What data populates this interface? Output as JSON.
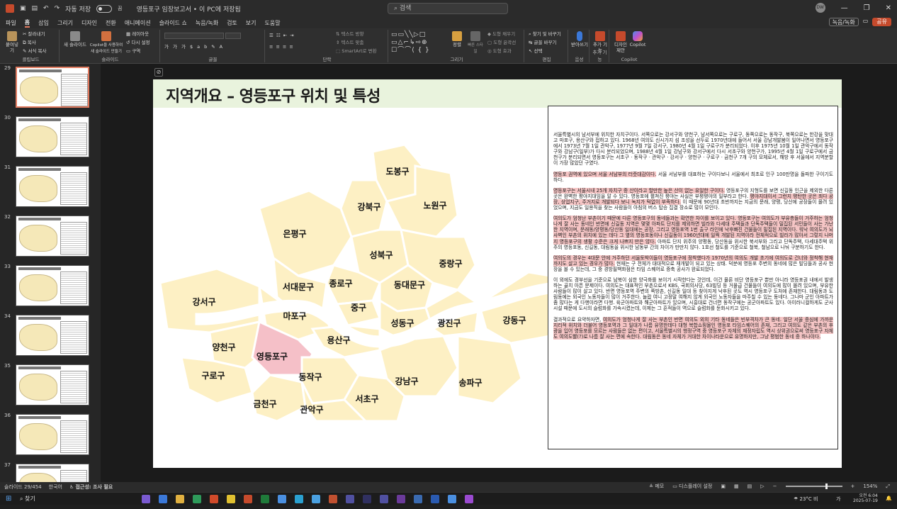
{
  "titlebar": {
    "autosave_label": "자동 저장",
    "autosave_state": "끔",
    "document_title": "영등포구 임장보고서 • 이 PC에 저장됨",
    "search_placeholder": "검색",
    "user_initials": "DW"
  },
  "tabs": [
    "파일",
    "홈",
    "삽입",
    "그리기",
    "디자인",
    "전환",
    "애니메이션",
    "슬라이드 쇼",
    "녹음/녹화",
    "검토",
    "보기",
    "도움말"
  ],
  "active_tab": "홈",
  "tabs_right": {
    "record": "녹음/녹화",
    "share": "공유"
  },
  "ribbon": {
    "clipboard": {
      "paste": "붙여넣기",
      "cut": "잘라내기",
      "copy": "복사",
      "format_painter": "서식 복사",
      "label": "클립보드"
    },
    "slides": {
      "new_slide": "새 슬라이드",
      "copilot": "Copilot을 사용하여 새 슬라이드 만들기",
      "layout": "레이아웃",
      "reset": "다시 설정",
      "section": "구역",
      "label": "슬라이드"
    },
    "font": {
      "label": "글꼴"
    },
    "paragraph": {
      "text_direction": "텍스트 방향",
      "align_text": "텍스트 맞춤",
      "smartart": "SmartArt로 변환",
      "label": "단락"
    },
    "drawing": {
      "arrange": "정렬",
      "quick_styles": "빠른 스타일",
      "shape_fill": "도형 채우기",
      "shape_outline": "도형 윤곽선",
      "shape_effects": "도형 효과",
      "label": "그리기"
    },
    "editing": {
      "find": "찾기 및 바꾸기",
      "replace": "글꼴 바꾸기",
      "select": "선택",
      "label": "편집"
    },
    "voice": {
      "dictate": "받아쓰기",
      "label": "음성"
    },
    "addins": {
      "addins": "추가 기능",
      "label": "추가 기능"
    },
    "designer": {
      "designer": "디자인 제안"
    },
    "copilot": {
      "copilot": "Copilot",
      "label": "Copilot"
    }
  },
  "thumbnails": [
    29,
    30,
    31,
    32,
    33,
    34,
    35,
    36,
    37
  ],
  "selected_thumbnail": 29,
  "slide": {
    "title": "지역개요 – 영등포구 위치 및 특성",
    "map_labels": [
      {
        "name": "도봉구",
        "highlight": false
      },
      {
        "name": "강북구",
        "highlight": false
      },
      {
        "name": "노원구",
        "highlight": false
      },
      {
        "name": "은평구",
        "highlight": false
      },
      {
        "name": "성북구",
        "highlight": false
      },
      {
        "name": "중랑구",
        "highlight": false
      },
      {
        "name": "종로구",
        "highlight": false
      },
      {
        "name": "서대문구",
        "highlight": false
      },
      {
        "name": "동대문구",
        "highlight": false
      },
      {
        "name": "강서구",
        "highlight": false
      },
      {
        "name": "마포구",
        "highlight": false
      },
      {
        "name": "중구",
        "highlight": false
      },
      {
        "name": "성동구",
        "highlight": false
      },
      {
        "name": "광진구",
        "highlight": false
      },
      {
        "name": "강동구",
        "highlight": false
      },
      {
        "name": "양천구",
        "highlight": false
      },
      {
        "name": "영등포구",
        "highlight": true
      },
      {
        "name": "용산구",
        "highlight": false
      },
      {
        "name": "구로구",
        "highlight": false
      },
      {
        "name": "동작구",
        "highlight": false
      },
      {
        "name": "강남구",
        "highlight": false
      },
      {
        "name": "송파구",
        "highlight": false
      },
      {
        "name": "서초구",
        "highlight": false
      },
      {
        "name": "금천구",
        "highlight": false
      },
      {
        "name": "관악구",
        "highlight": false
      }
    ],
    "paragraphs": [
      {
        "plain": "서울특별시의 남서부에 위치한 자치구이다. 서쪽으로는 강서구와 양천구, 남서쪽으로는 구로구, 동쪽으로는 동작구, 북쪽으로는 한강을 맞대고 마포구, 용산구와 접하고 있다. 1968년 여의도 신시가지 섬 조성을 선두로 1970년대에 들어서 서울 강남개발붐이 일어나면서 영등포구에서 1973년 7월 1일 관악구, 1977년 9월 7일 강서구, 1980년 4월 1일 구로구가 분리되었다. 이후 1975년 10월 1일 관악구에서 동작구와 강남구(일부)가 다시 분리되었으며, 1988년 4월 1일 강남구와 강서구에서 다시 서초구와 양천구가, 1995년 4월 1일 구로구에서 금천구가 분리되면서 영등포구는 서초구 · 동작구 · 관악구 · 강서구 · 양천구 · 구로구 · 금천구 7개 구의 모체로서, 해방 후 서울에서 지역분할이 가장 많았던 구였다."
      },
      {
        "hl": "영등포 권역에 있으며 서울 서남부의 터줏대감이다.",
        "plain": " 서울 서남부를 대표하는 구이다보니 서울에서 최초로 인구 100만명을 돌파한 구이기도 하다."
      },
      {
        "hl": "영등포구는 서울시내 25개 자치구 중 산이라고 할만한 높은 산이 없는 유일한 구이다.",
        "plain": " 영등포구의 지형도를 보면 신길동 인근을 제외한 다른 곳은 완벽한 평야지대임을 알 수 있다. 영등포에 펼쳐진 평야는 사실은 부평평야의 일부라고 한다. ",
        "hl2": "평야지대이서 그런지 평탄한 곳은 죄다 공장, 상업지구, 주거지로 개발되다 보니 녹지가 턱없이 부족하다.",
        "plain2": " 이 때문에 90년대 초반까지는 지금의 문래, 양평, 당산에 공장들이 몰려 있었으며, 지금도 일용직을 찾는 사람들이 아침의 버스 탑승 집결 장소로 많이 모인다."
      },
      {
        "hl": "여의도가 엄청난 부촌이기 때문에 다른 영등포구의 동네들과는 확연한 차이를 보이고 있다. 영등포구는 여의도가 부유층들이 거주하는 엄청나게 잘 사는 동네인 반면에 신길동 지역은 몇몇 아파트 단지를 제외하면 빌라와 다세대 주택들과 단독주택들이 밀집된 서민들이 사는 가난한 지역이며, 문래동/양평동/당산동 일대에는 공장, 그리고 영등포역 1번 출구 라인에 낙후빠진 건물들이 밀집된 지역이다. 워낙 여의도가 뇌사벽인 부촌의 위치에 있는 데다 그 옆의 영등포동이나 신길동이 1960년대에 일찍 개발된 지역이라 전체적으로 빌라가 많아서 그렇지 나머지 영등포구의 생활 수준은 크게 나쁘지 만은 않다.",
        "plain": " 아파트 단지 위주의 양평동, 당산동을 위시한 북서부와 그리고 단독주택, 다세대주택 위주의 영등포동, 신길동, 대림동을 위시한 남동부 간의 차이가 만만치 않다. 1호선 철도를 기준으로 철북, 철남으로 나눠 구분하기도 한다."
      },
      {
        "hl": "여의도의 경우는 4대문 안에 거주하던 서울토박이들이 영등포구에 정착했다가 1970년의 여의도 개발 초기에 여의도로 건너와 정착해 현재까지도 살고 있는 경우가 많다.",
        "plain": " 현재는 구 전체가 대대적으로 재개발이 되고 있는 상태. 덕분에 영등포 주변의 동네에 많은 빌딩들과 공사 현장을 볼 수 있는데, 그 중 경방필백화점은 타임 스퀘어로 증축 공사가 완료되었다."
      },
      {
        "plain": "이 외에도 경부선을 기준으로 남북이 심한 양극화를 보이기 시작한다는 것인데, 이건 물론 비단 영등포구 뿐만 아니라 영등포권 내에서 발생하는 골치 아픈 문제이다. 여의도는 대표적인 부촌으로서 KBS, 국회의사당, 63빌딩 등 거물급 건물들이 여의도에 많이 몰려 있으며, 부유한 사람들이 많이 살고 있다. 반면 영등포역 주변의 쪽방촌, 신길동 일대 등 찾아지게 낙후된 곳도 역시 영등포구 도처에 존재한다. 대림동과 도림동에는 외국인 노동자들이 많이 거주한다. 놀랍 여니 고정말 여해지 않게 외국인 노동자들을 마주칠 수 있는 동네다. 그나마 군인 아파트가 좀 많다는 게 다행이라면 다행. 육군아파트와 해군아파트가 있으며, 시흥대로 건너편 동작구에는 공군아파트도 있다. 아이러니컬하게도 군사시설 때문에 도시의 슬럼화를 가속시켰는데, 이제는 그 흔적들이 역으로 슬럼화를 둔화시키고 있다."
      },
      {
        "plain": "결과적으로 요약하자면, ",
        "hl": "여의도가 엄청나게 잘 사는 부촌인 반면 여의도 외의 기타 동네들은 빈부격차가 큰 동네. 일단 서울 중심에 가까운 지리적 위치와 더불어 영등포역과 그 일대가 나름 유명한데다 대형 복합쇼핑몰인 영등포 타임스퀘어의 존재, 그리고 여의도 같은 부촌의 후광을 입어 영등포를 모르는 사람들은 없는 편이고, 서울특별시의 행정구역 중 영등포구 자체의 재정자립도 역시 상위권으로써 영등포구 자체도 여의도빨(?)로 나름 잘 사는 편에 속한다. 대림동은 동네 자체가 거대한 차이나타운으로 유명하지만, 그냥 평범한 동네 중 하나이다."
      }
    ]
  },
  "statusbar": {
    "slide_counter": "슬라이드 29/454",
    "language": "한국어",
    "accessibility": "접근성: 조사 필요",
    "notes": "메모",
    "display": "디스플레이 설정",
    "zoom": "154%"
  },
  "taskbar": {
    "search": "찾기",
    "weather": "23°C 비",
    "time": "오전 6:04",
    "date": "2025-07-19",
    "ime": "가"
  },
  "colors": {
    "accent": "#e07a5f",
    "highlight_district": "#f5c0c8",
    "district_fill": "#fdf0c4",
    "title_band": "#e9f3dd",
    "text_highlight": "#f5c5c5"
  }
}
